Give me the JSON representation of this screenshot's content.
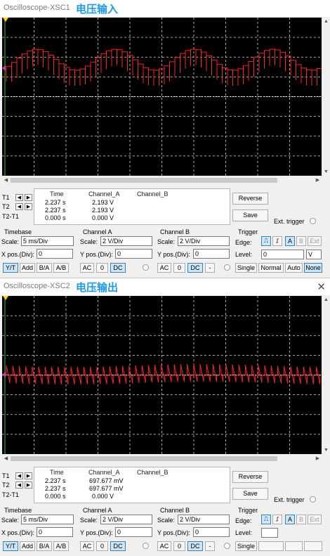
{
  "scopes": [
    {
      "window_title": "Oscilloscope-XSC1",
      "cn_label": "电压输入",
      "headers": {
        "time": "Time",
        "a": "Channel_A",
        "b": "Channel_B"
      },
      "rows": [
        {
          "label": "T1",
          "time": "2.237 s",
          "a": "2.193 V",
          "b": ""
        },
        {
          "label": "T2",
          "time": "2.237 s",
          "a": "2.193 V",
          "b": ""
        },
        {
          "label": "T2-T1",
          "time": "0.000 s",
          "a": "0.000 V",
          "b": ""
        }
      ],
      "reverse": "Reverse",
      "save": "Save",
      "ext_trigger": "Ext. trigger",
      "timebase": {
        "title": "Timebase",
        "scale_label": "Scale:",
        "scale": "5 ms/Div",
        "pos_label": "X pos.(Div):",
        "pos": "0",
        "buttons": [
          "Y/T",
          "Add",
          "B/A",
          "A/B"
        ]
      },
      "channel_a": {
        "title": "Channel A",
        "scale_label": "Scale:",
        "scale": "2  V/Div",
        "pos_label": "Y pos.(Div):",
        "pos": "0",
        "buttons": [
          "AC",
          "0",
          "DC"
        ]
      },
      "channel_b": {
        "title": "Channel B",
        "scale_label": "Scale:",
        "scale": "2  V/Div",
        "pos_label": "Y pos.(Div):",
        "pos": "0",
        "buttons": [
          "AC",
          "0",
          "DC",
          "-"
        ]
      },
      "trigger": {
        "title": "Trigger",
        "edge_label": "Edge:",
        "edge_buttons": [
          "A",
          "B",
          "Ext"
        ],
        "level_label": "Level:",
        "level": "0",
        "level_unit": "V",
        "modes": [
          "Single",
          "Normal",
          "Auto",
          "None"
        ]
      }
    },
    {
      "window_title": "Oscilloscope-XSC2",
      "cn_label": "电压输出",
      "headers": {
        "time": "Time",
        "a": "Channel_A",
        "b": "Channel_B"
      },
      "rows": [
        {
          "label": "T1",
          "time": "2.237 s",
          "a": "697.677 mV",
          "b": ""
        },
        {
          "label": "T2",
          "time": "2.237 s",
          "a": "697.677 mV",
          "b": ""
        },
        {
          "label": "T2-T1",
          "time": "0.000 s",
          "a": "0.000 V",
          "b": ""
        }
      ],
      "reverse": "Reverse",
      "save": "Save",
      "ext_trigger": "Ext. trigger",
      "timebase": {
        "title": "Timebase",
        "scale_label": "Scale:",
        "scale": "5 ms/Div",
        "pos_label": "X pos.(Div):",
        "pos": "0",
        "buttons": [
          "Y/T",
          "Add",
          "B/A",
          "A/B"
        ]
      },
      "channel_a": {
        "title": "Channel A",
        "scale_label": "Scale:",
        "scale": "2  V/Div",
        "pos_label": "Y pos.(Div):",
        "pos": "0",
        "buttons": [
          "AC",
          "0",
          "DC"
        ]
      },
      "channel_b": {
        "title": "Channel B",
        "scale_label": "Scale:",
        "scale": "2  V/Div",
        "pos_label": "Y pos.(Div):",
        "pos": "0",
        "buttons": [
          "AC",
          "0",
          "DC",
          "-"
        ]
      },
      "trigger": {
        "title": "Trigger",
        "edge_label": "Edge:",
        "edge_buttons": [
          "A",
          "B",
          "Ext"
        ],
        "level_label": "Level:",
        "level": "",
        "level_unit": "",
        "modes": [
          "Single",
          "",
          "",
          ""
        ]
      }
    }
  ],
  "colors": {
    "trace": "#ff2020",
    "grid": "#d8d8d8",
    "screen": "#000000",
    "title_cn": "#1e9be0"
  }
}
